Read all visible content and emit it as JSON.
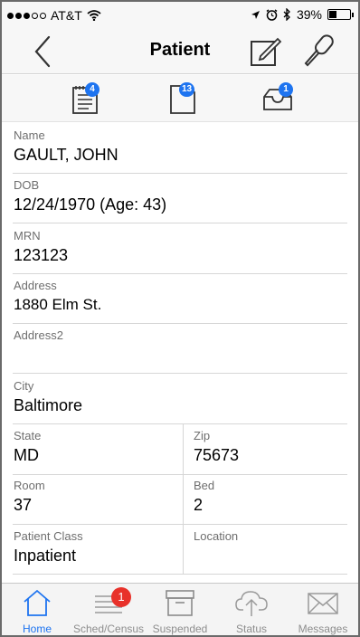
{
  "status_bar": {
    "carrier": "AT&T",
    "battery_percent": "39%",
    "battery_level": 0.39,
    "signal_bars_filled": 3,
    "signal_bars_total": 5
  },
  "nav": {
    "title": "Patient"
  },
  "toolbar": {
    "notes_badge": "4",
    "documents_badge": "13",
    "inbox_badge": "1"
  },
  "fields": {
    "name": {
      "label": "Name",
      "value": "GAULT, JOHN"
    },
    "dob": {
      "label": "DOB",
      "value": "12/24/1970 (Age: 43)"
    },
    "mrn": {
      "label": "MRN",
      "value": "123123"
    },
    "address": {
      "label": "Address",
      "value": "1880 Elm St."
    },
    "address2": {
      "label": "Address2",
      "value": ""
    },
    "city": {
      "label": "City",
      "value": "Baltimore"
    },
    "state": {
      "label": "State",
      "value": "MD"
    },
    "zip": {
      "label": "Zip",
      "value": "75673"
    },
    "room": {
      "label": "Room",
      "value": "37"
    },
    "bed": {
      "label": "Bed",
      "value": "2"
    },
    "patient_class": {
      "label": "Patient Class",
      "value": "Inpatient"
    },
    "location": {
      "label": "Location",
      "value": ""
    }
  },
  "tabbar": {
    "tabs": [
      {
        "label": "Home",
        "icon": "home-icon",
        "active": true
      },
      {
        "label": "Sched/Census",
        "icon": "list-icon",
        "badge": "1"
      },
      {
        "label": "Suspended",
        "icon": "archive-box-icon"
      },
      {
        "label": "Status",
        "icon": "cloud-upload-icon"
      },
      {
        "label": "Messages",
        "icon": "envelope-icon"
      }
    ]
  },
  "colors": {
    "accent": "#1e74f0",
    "badge_red": "#e8312a",
    "label_gray": "#6e6e6e"
  }
}
